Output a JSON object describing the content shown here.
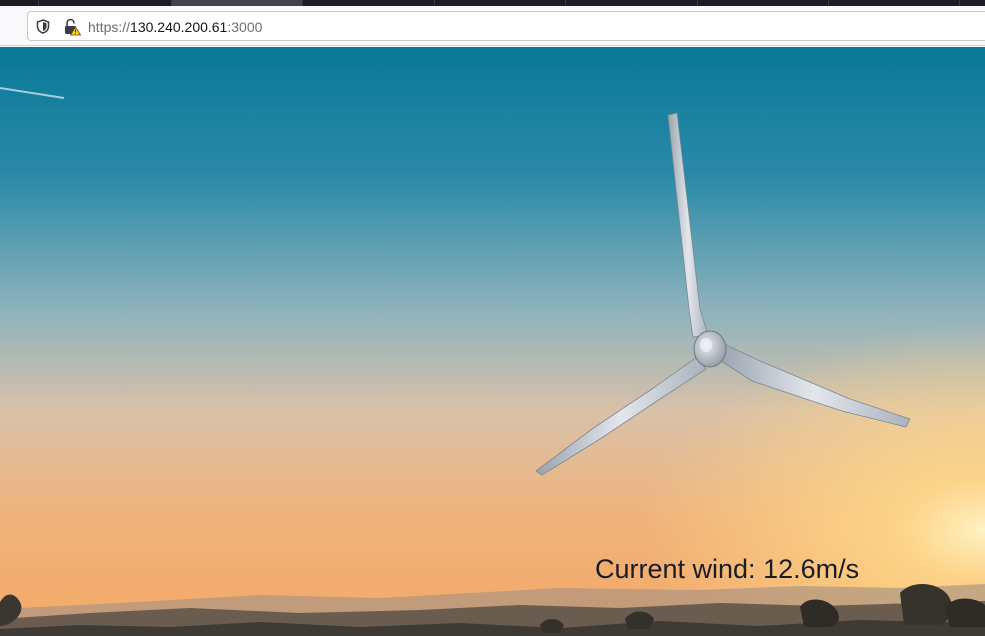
{
  "browser": {
    "address_bar": {
      "scheme": "https://",
      "host": "130.240.200.61",
      "port": ":3000"
    },
    "icons": {
      "tracking_protection": "shield-icon",
      "connection_security": "insecure-lock-warning-icon"
    }
  },
  "page": {
    "wind_label": "Current wind: 12.6m/s",
    "background": {
      "sky_top_color": "#0d7c9e",
      "sky_bottom_color": "#f5b469",
      "sun_color": "#ffd98a",
      "turbine_color": "#c9ced6",
      "hills_color": "#3e3a35"
    }
  }
}
